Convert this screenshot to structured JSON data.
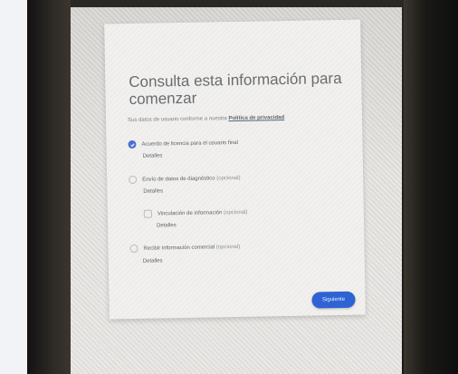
{
  "dialog": {
    "title": "Consulta esta información para comenzar",
    "subtitle_prefix": "Sus datos de usuario conforme a nuestra ",
    "subtitle_link": "Política de privacidad",
    "options": [
      {
        "label": "Acuerdo de licencia para el usuario final",
        "optional": "",
        "details": "Detalles",
        "checked": true
      },
      {
        "label": "Envío de datos de diagnóstico ",
        "optional": "(opcional)",
        "details": "Detalles",
        "checked": false
      },
      {
        "label": "Vinculación de información ",
        "optional": "(opcional)",
        "details": "Detalles",
        "checked": false
      },
      {
        "label": "Recibir información comercial ",
        "optional": "(opcional)",
        "details": "Detalles",
        "checked": false
      }
    ],
    "next_label": "Siguiente"
  },
  "colors": {
    "accent": "#2f63d3",
    "checked": "#4a6fd3"
  }
}
